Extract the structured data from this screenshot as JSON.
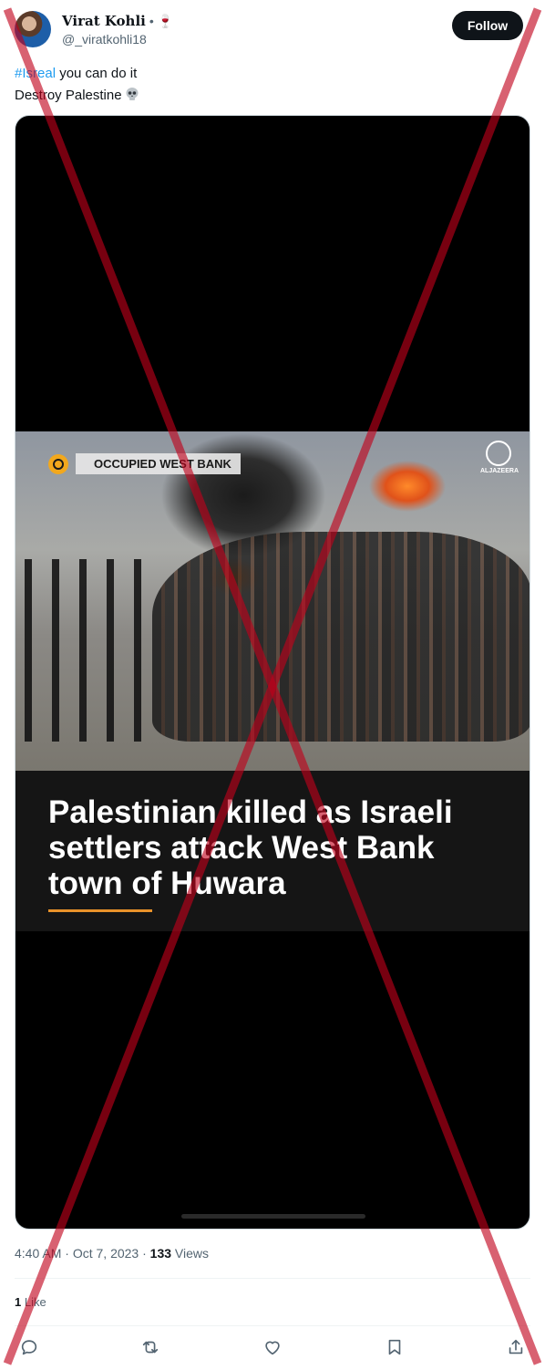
{
  "author": {
    "display_name": "Virat Kohli",
    "name_suffix": "• 🍷",
    "handle": "@_viratkohli18",
    "follow_label": "Follow"
  },
  "tweet": {
    "hashtag": "#Isreal",
    "line1_rest": " you can do it",
    "line2": "Destroy Palestine"
  },
  "media": {
    "location_label": "OCCUPIED WEST BANK",
    "logo_text": "ALJAZEERA",
    "headline": "Palestinian killed as Israeli settlers attack West Bank town of Huwara"
  },
  "meta": {
    "time": "4:40 AM",
    "sep1": " · ",
    "date": "Oct 7, 2023",
    "sep2": " · ",
    "views_count": "133",
    "views_label": " Views"
  },
  "engagement": {
    "likes_count": "1",
    "likes_label": " Like"
  },
  "actions": [
    {
      "icon": "reply-icon"
    },
    {
      "icon": "retweet-icon"
    },
    {
      "icon": "like-icon"
    },
    {
      "icon": "bookmark-icon"
    },
    {
      "icon": "share-icon"
    }
  ],
  "colors": {
    "accent": "#1d9bf0",
    "text_primary": "#0f1419",
    "text_secondary": "#536471",
    "overlay_x": "#c0001a"
  }
}
